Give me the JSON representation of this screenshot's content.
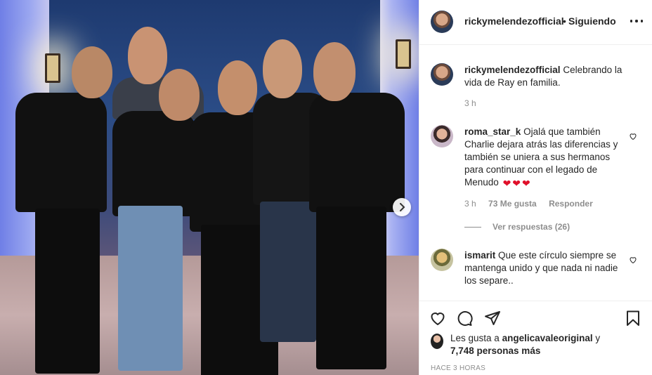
{
  "post": {
    "username": "rickymelendezofficial",
    "separator": "•",
    "follow_status": "Siguiendo"
  },
  "caption": {
    "username": "rickymelendezofficial",
    "text": "Celebrando la vida de Ray en familia.",
    "time": "3 h"
  },
  "comments": [
    {
      "username": "roma_star_k",
      "text": "Ojalá que también Charlie dejara atrás las diferencias y también se uniera a sus hermanos para continuar con el legado de Menudo",
      "emoji": "❤❤❤",
      "time": "3 h",
      "likes": "73 Me gusta",
      "reply": "Responder",
      "view_replies": "Ver respuestas (26)"
    },
    {
      "username": "ismarit",
      "text": "Que este círculo siempre se mantenga unido y que nada ni nadie los separe.."
    }
  ],
  "likes": {
    "prefix": "Les gusta a",
    "user": "angelicavaleoriginal",
    "joiner": "y",
    "count": "7,748 personas más"
  },
  "posted_time": "HACE 3 HORAS",
  "colors": {
    "heart": "#ed4956",
    "muted": "#8e8e8e",
    "text": "#262626"
  }
}
